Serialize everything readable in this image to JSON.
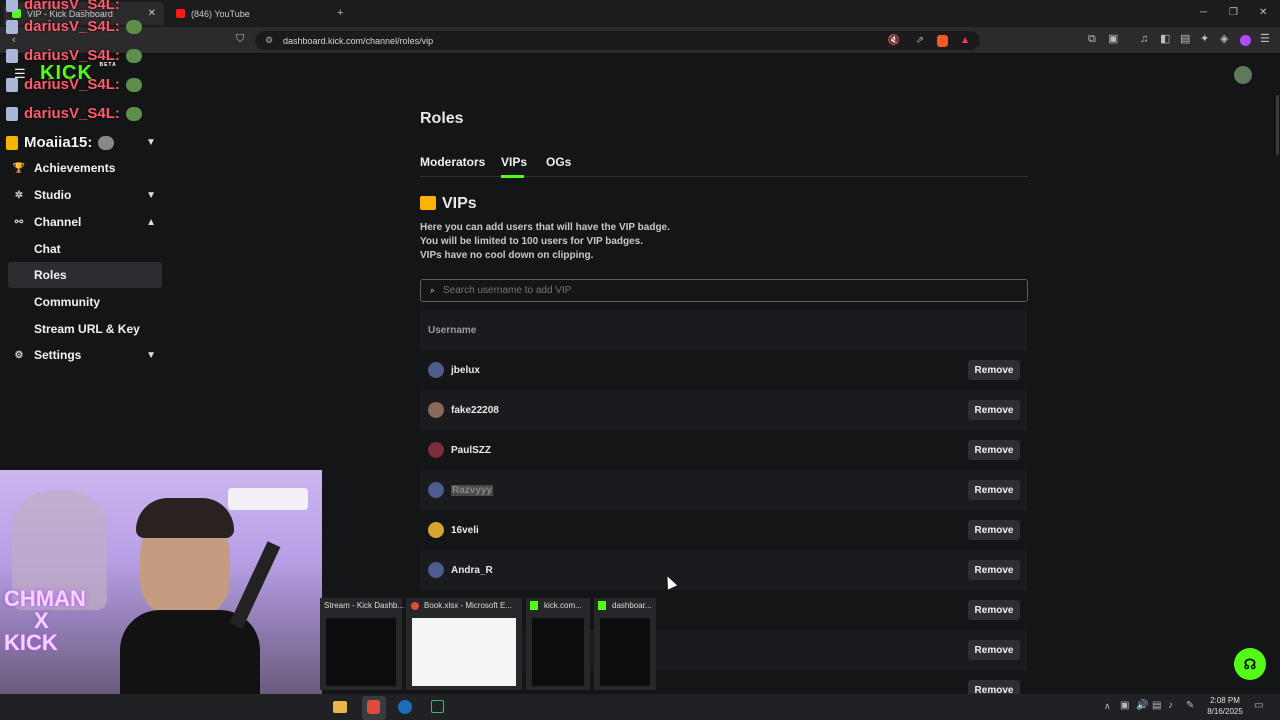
{
  "browser": {
    "tabs": [
      {
        "label": "VIP - Kick Dashboard",
        "active": true
      },
      {
        "label": "(846) YouTube",
        "active": false
      }
    ],
    "url": "dashboard.kick.com/channel/roles/vip",
    "accent": "#53fc18"
  },
  "overlay_chat": {
    "lines": [
      "dariusV_S4L:",
      "dariusV_S4L:",
      "dariusV_S4L:",
      "dariusV_S4L:",
      "dariusV_S4L:"
    ],
    "partial_user": "Moaiia15:"
  },
  "logo": {
    "text": "KICK",
    "tag": "BETA"
  },
  "sidebar": {
    "items": [
      {
        "label": "Achievements",
        "icon": "trophy-icon"
      },
      {
        "label": "Studio",
        "icon": "studio-icon"
      },
      {
        "label": "Channel",
        "icon": "channel-icon"
      },
      {
        "label": "Settings",
        "icon": "gear-icon"
      }
    ],
    "channel_sub": [
      "Chat",
      "Roles",
      "Community",
      "Stream URL & Key"
    ]
  },
  "main": {
    "title": "Roles",
    "tabs": [
      "Moderators",
      "VIPs",
      "OGs"
    ],
    "section_title": "VIPs",
    "description": [
      "Here you can add users that will have the VIP badge.",
      "You will be limited to 100 users for VIP badges.",
      "VIPs have no cool down on clipping."
    ],
    "search_placeholder": "Search username to add VIP",
    "column_header": "Username",
    "remove_label": "Remove",
    "users": [
      "jbelux",
      "fake22208",
      "PaulSZZ",
      "Razvyyy",
      "16veli",
      "Andra_R"
    ]
  },
  "webcam": {
    "caption_1": "CHMAN",
    "caption_2": "X",
    "caption_3": "KICK"
  },
  "taskbar_previews": [
    "Stream - Kick Dashb...",
    "Book.xlsx - Microsoft E...",
    "kick.com...",
    "dashboar..."
  ],
  "clock": {
    "time": "2:08 PM",
    "date": "8/16/2025"
  }
}
